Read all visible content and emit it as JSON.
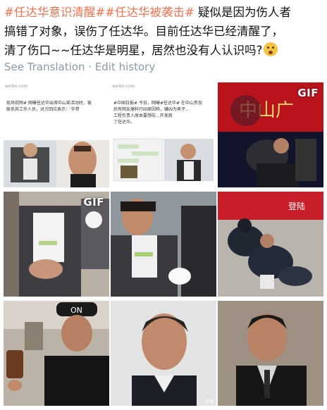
{
  "post": {
    "hashtag1": "#任达华意识清醒#",
    "hashtag2": "#任达华被袭击#",
    "text_line1": " 疑似是因为伤人者",
    "text_line2": "搞错了对象，误伤了任达华。目前任达华已经清醒了，",
    "text_line3": "清了伤口~~任达华是明星，居然也没有人认识吗?",
    "emoji": "thinking-face-emoji"
  },
  "meta": {
    "see_translation": "See Translation",
    "separator": " · ",
    "edit_history": "Edit history"
  },
  "images": {
    "img1": {
      "site": "weibo.com",
      "line1": "现场视频# 网曝任达华出席中山某活动时，被",
      "line2": "联系其工作人员，对方回应表示：'华哥",
      "badge": ""
    },
    "img2": {
      "site": "weibo.com",
      "line1": "#中国日报# 今日，网曝#任达华# 在中山参加",
      "line2": "后有网友爆料行凶原因称，嫌凶为男子...",
      "line3": "工程负责人原本要想砍...开发商",
      "line4": "了任达华。",
      "badge": ""
    },
    "img3": {
      "gif_label": "GIF",
      "banner_text": "中山广"
    },
    "img4": {
      "gif_label": "GIF"
    },
    "img5": {},
    "img6": {
      "banner_text": "登陆"
    },
    "img7": {
      "cap_text": "ON"
    },
    "img8": {
      "watermark": "微博"
    },
    "img9": {}
  }
}
